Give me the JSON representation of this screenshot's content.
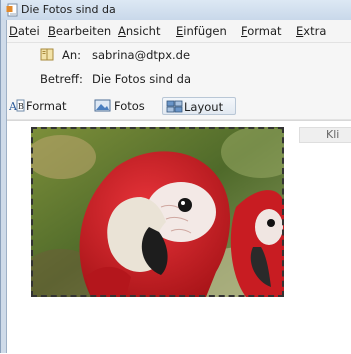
{
  "window": {
    "title": "Die Fotos sind da"
  },
  "menubar": {
    "items": [
      {
        "accel": "D",
        "rest": "atei"
      },
      {
        "accel": "B",
        "rest": "earbeiten"
      },
      {
        "accel": "A",
        "rest": "nsicht"
      },
      {
        "accel": "E",
        "rest": "infügen"
      },
      {
        "accel": "F",
        "rest": "ormat"
      },
      {
        "accel": "E",
        "rest": "xtra"
      }
    ]
  },
  "header": {
    "to_label": "An:",
    "to_value": "sabrina@dtpx.de",
    "subject_label": "Betreff:",
    "subject_value": "Die Fotos sind da"
  },
  "toolbar": {
    "format_label": "Format",
    "photos_label": "Fotos",
    "layout_label": "Layout"
  },
  "body": {
    "hint_text": "Kli"
  },
  "colors": {
    "window_frame": "#cfdbe9",
    "accent": "#3a6ea5"
  }
}
